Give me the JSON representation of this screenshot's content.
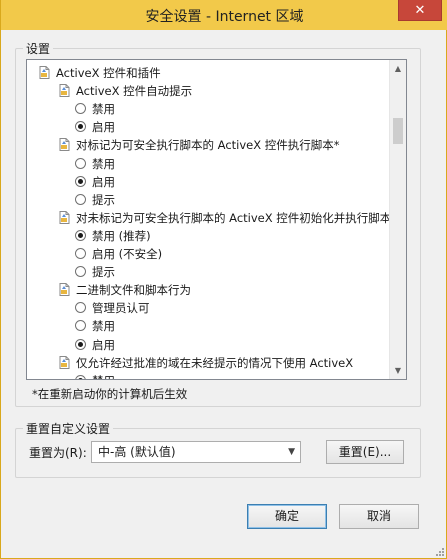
{
  "window": {
    "title": "安全设置 - Internet 区域",
    "close_glyph": "✕"
  },
  "settings_group": {
    "label": "设置"
  },
  "tree": {
    "rows": [
      {
        "type": "category",
        "label": "ActiveX 控件和插件",
        "indent": 0
      },
      {
        "type": "setting",
        "label": "ActiveX 控件自动提示",
        "indent": 1
      },
      {
        "type": "option",
        "label": "禁用",
        "checked": false,
        "indent": 2
      },
      {
        "type": "option",
        "label": "启用",
        "checked": true,
        "indent": 2
      },
      {
        "type": "setting",
        "label": "对标记为可安全执行脚本的 ActiveX 控件执行脚本*",
        "indent": 1
      },
      {
        "type": "option",
        "label": "禁用",
        "checked": false,
        "indent": 2
      },
      {
        "type": "option",
        "label": "启用",
        "checked": true,
        "indent": 2
      },
      {
        "type": "option",
        "label": "提示",
        "checked": false,
        "indent": 2
      },
      {
        "type": "setting",
        "label": "对未标记为可安全执行脚本的 ActiveX 控件初始化并执行脚本",
        "indent": 1
      },
      {
        "type": "option",
        "label": "禁用 (推荐)",
        "checked": true,
        "indent": 2
      },
      {
        "type": "option",
        "label": "启用 (不安全)",
        "checked": false,
        "indent": 2
      },
      {
        "type": "option",
        "label": "提示",
        "checked": false,
        "indent": 2
      },
      {
        "type": "setting",
        "label": "二进制文件和脚本行为",
        "indent": 1
      },
      {
        "type": "option",
        "label": "管理员认可",
        "checked": false,
        "indent": 2
      },
      {
        "type": "option",
        "label": "禁用",
        "checked": false,
        "indent": 2
      },
      {
        "type": "option",
        "label": "启用",
        "checked": true,
        "indent": 2
      },
      {
        "type": "setting",
        "label": "仅允许经过批准的域在未经提示的情况下使用 ActiveX",
        "indent": 1
      },
      {
        "type": "option",
        "label": "禁用",
        "checked": true,
        "indent": 2
      }
    ]
  },
  "restart_note": "*在重新启动你的计算机后生效",
  "reset_group": {
    "label": "重置自定义设置",
    "reset_to_label": "重置为(R):",
    "selected_level": "中-高 (默认值)",
    "reset_button": "重置(E)..."
  },
  "footer": {
    "ok_button": "确定",
    "cancel_button": "取消"
  },
  "colors": {
    "titlebar": "#f2c94a",
    "close": "#c7473a",
    "default_button_border": "#3c7fb1"
  }
}
